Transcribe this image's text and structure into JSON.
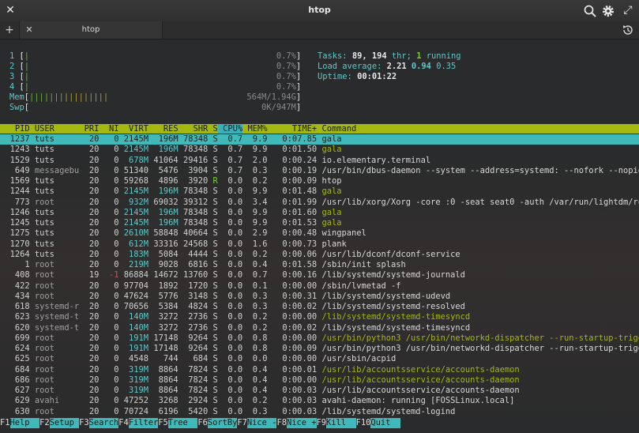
{
  "window": {
    "title": "htop"
  },
  "tabs": [
    {
      "label": "htop"
    }
  ],
  "meters": {
    "cpus": [
      {
        "num": "1",
        "pct": "0.7%"
      },
      {
        "num": "2",
        "pct": "0.7%"
      },
      {
        "num": "3",
        "pct": "0.7%"
      },
      {
        "num": "4",
        "pct": "0.7%"
      }
    ],
    "mem": {
      "label": "Mem",
      "value": "564M/1.94G",
      "fill": 0.29
    },
    "swp": {
      "label": "Swp",
      "value": "0K/947M",
      "fill": 0
    }
  },
  "stats": {
    "tasks_label": "Tasks:",
    "tasks": "89,",
    "threads": "194",
    "thr_label": "thr;",
    "running": "1",
    "running_label": "running",
    "load_label": "Load average:",
    "load1": "2.21",
    "load5": "0.94",
    "load15": "0.35",
    "uptime_label": "Uptime:",
    "uptime": "00:01:22"
  },
  "columns": [
    "PID",
    "USER",
    "PRI",
    "NI",
    "VIRT",
    "RES",
    "SHR",
    "S",
    "CPU%",
    "MEM%",
    "TIME+",
    "Command"
  ],
  "processes": [
    {
      "pid": "1237",
      "user": "tuts",
      "pri": "20",
      "ni": "0",
      "virt": "2145M",
      "res": "196M",
      "shr": "78348",
      "s": "S",
      "cpu": "0.7",
      "mem": "9.9",
      "time": "0:07.85",
      "cmd": "gala",
      "selected": true
    },
    {
      "pid": "1243",
      "user": "tuts",
      "pri": "20",
      "ni": "0",
      "virt": "2145M",
      "res": "196M",
      "shr": "78348",
      "s": "S",
      "cpu": "0.7",
      "mem": "9.9",
      "time": "0:01.50",
      "cmd": "gala",
      "thread": true
    },
    {
      "pid": "1529",
      "user": "tuts",
      "pri": "20",
      "ni": "0",
      "virt": "678M",
      "res": "41064",
      "shr": "29416",
      "s": "S",
      "cpu": "0.7",
      "mem": "2.0",
      "time": "0:00.24",
      "cmd": "io.elementary.terminal"
    },
    {
      "pid": "649",
      "user": "messagebu",
      "pri": "20",
      "ni": "0",
      "virt": "51340",
      "res": "5476",
      "shr": "3904",
      "s": "S",
      "cpu": "0.7",
      "mem": "0.3",
      "time": "0:00.19",
      "cmd": "/usr/bin/dbus-daemon --system --address=systemd: --nofork --nopid"
    },
    {
      "pid": "1569",
      "user": "tuts",
      "pri": "20",
      "ni": "0",
      "virt": "59268",
      "res": "4896",
      "shr": "3920",
      "s": "R",
      "cpu": "0.0",
      "mem": "0.2",
      "time": "0:00.09",
      "cmd": "htop"
    },
    {
      "pid": "1244",
      "user": "tuts",
      "pri": "20",
      "ni": "0",
      "virt": "2145M",
      "res": "196M",
      "shr": "78348",
      "s": "S",
      "cpu": "0.0",
      "mem": "9.9",
      "time": "0:01.48",
      "cmd": "gala",
      "thread": true
    },
    {
      "pid": "773",
      "user": "root",
      "pri": "20",
      "ni": "0",
      "virt": "932M",
      "res": "69032",
      "shr": "39312",
      "s": "S",
      "cpu": "0.0",
      "mem": "3.4",
      "time": "0:01.99",
      "cmd": "/usr/lib/xorg/Xorg -core :0 -seat seat0 -auth /var/run/lightdm/ro"
    },
    {
      "pid": "1246",
      "user": "tuts",
      "pri": "20",
      "ni": "0",
      "virt": "2145M",
      "res": "196M",
      "shr": "78348",
      "s": "S",
      "cpu": "0.0",
      "mem": "9.9",
      "time": "0:01.60",
      "cmd": "gala",
      "thread": true
    },
    {
      "pid": "1245",
      "user": "tuts",
      "pri": "20",
      "ni": "0",
      "virt": "2145M",
      "res": "196M",
      "shr": "78348",
      "s": "S",
      "cpu": "0.0",
      "mem": "9.9",
      "time": "0:01.53",
      "cmd": "gala",
      "thread": true
    },
    {
      "pid": "1275",
      "user": "tuts",
      "pri": "20",
      "ni": "0",
      "virt": "2610M",
      "res": "58848",
      "shr": "40664",
      "s": "S",
      "cpu": "0.0",
      "mem": "2.9",
      "time": "0:00.48",
      "cmd": "wingpanel"
    },
    {
      "pid": "1270",
      "user": "tuts",
      "pri": "20",
      "ni": "0",
      "virt": "612M",
      "res": "33316",
      "shr": "24568",
      "s": "S",
      "cpu": "0.0",
      "mem": "1.6",
      "time": "0:00.73",
      "cmd": "plank"
    },
    {
      "pid": "1264",
      "user": "tuts",
      "pri": "20",
      "ni": "0",
      "virt": "183M",
      "res": "5084",
      "shr": "4444",
      "s": "S",
      "cpu": "0.0",
      "mem": "0.2",
      "time": "0:00.06",
      "cmd": "/usr/lib/dconf/dconf-service"
    },
    {
      "pid": "1",
      "user": "root",
      "pri": "20",
      "ni": "0",
      "virt": "219M",
      "res": "9028",
      "shr": "6816",
      "s": "S",
      "cpu": "0.0",
      "mem": "0.4",
      "time": "0:01.58",
      "cmd": "/sbin/init splash"
    },
    {
      "pid": "408",
      "user": "root",
      "pri": "19",
      "ni": "-1",
      "virt": "86884",
      "res": "14672",
      "shr": "13760",
      "s": "S",
      "cpu": "0.0",
      "mem": "0.7",
      "time": "0:00.16",
      "cmd": "/lib/systemd/systemd-journald"
    },
    {
      "pid": "422",
      "user": "root",
      "pri": "20",
      "ni": "0",
      "virt": "97704",
      "res": "1892",
      "shr": "1720",
      "s": "S",
      "cpu": "0.0",
      "mem": "0.1",
      "time": "0:00.00",
      "cmd": "/sbin/lvmetad -f"
    },
    {
      "pid": "434",
      "user": "root",
      "pri": "20",
      "ni": "0",
      "virt": "47624",
      "res": "5776",
      "shr": "3148",
      "s": "S",
      "cpu": "0.0",
      "mem": "0.3",
      "time": "0:00.31",
      "cmd": "/lib/systemd/systemd-udevd"
    },
    {
      "pid": "618",
      "user": "systemd-r",
      "pri": "20",
      "ni": "0",
      "virt": "70656",
      "res": "5384",
      "shr": "4824",
      "s": "S",
      "cpu": "0.0",
      "mem": "0.3",
      "time": "0:00.02",
      "cmd": "/lib/systemd/systemd-resolved"
    },
    {
      "pid": "623",
      "user": "systemd-t",
      "pri": "20",
      "ni": "0",
      "virt": "140M",
      "res": "3272",
      "shr": "2736",
      "s": "S",
      "cpu": "0.0",
      "mem": "0.2",
      "time": "0:00.00",
      "cmd": "/lib/systemd/systemd-timesyncd",
      "thread": true
    },
    {
      "pid": "620",
      "user": "systemd-t",
      "pri": "20",
      "ni": "0",
      "virt": "140M",
      "res": "3272",
      "shr": "2736",
      "s": "S",
      "cpu": "0.0",
      "mem": "0.2",
      "time": "0:00.02",
      "cmd": "/lib/systemd/systemd-timesyncd"
    },
    {
      "pid": "699",
      "user": "root",
      "pri": "20",
      "ni": "0",
      "virt": "191M",
      "res": "17148",
      "shr": "9264",
      "s": "S",
      "cpu": "0.0",
      "mem": "0.8",
      "time": "0:00.00",
      "cmd": "/usr/bin/python3 /usr/bin/networkd-dispatcher --run-startup-trigg",
      "thread": true
    },
    {
      "pid": "624",
      "user": "root",
      "pri": "20",
      "ni": "0",
      "virt": "191M",
      "res": "17148",
      "shr": "9264",
      "s": "S",
      "cpu": "0.0",
      "mem": "0.8",
      "time": "0:00.09",
      "cmd": "/usr/bin/python3 /usr/bin/networkd-dispatcher --run-startup-trigg"
    },
    {
      "pid": "625",
      "user": "root",
      "pri": "20",
      "ni": "0",
      "virt": "4548",
      "res": "744",
      "shr": "684",
      "s": "S",
      "cpu": "0.0",
      "mem": "0.0",
      "time": "0:00.00",
      "cmd": "/usr/sbin/acpid"
    },
    {
      "pid": "684",
      "user": "root",
      "pri": "20",
      "ni": "0",
      "virt": "319M",
      "res": "8864",
      "shr": "7824",
      "s": "S",
      "cpu": "0.0",
      "mem": "0.4",
      "time": "0:00.01",
      "cmd": "/usr/lib/accountsservice/accounts-daemon",
      "thread": true
    },
    {
      "pid": "686",
      "user": "root",
      "pri": "20",
      "ni": "0",
      "virt": "319M",
      "res": "8864",
      "shr": "7824",
      "s": "S",
      "cpu": "0.0",
      "mem": "0.4",
      "time": "0:00.00",
      "cmd": "/usr/lib/accountsservice/accounts-daemon",
      "thread": true
    },
    {
      "pid": "627",
      "user": "root",
      "pri": "20",
      "ni": "0",
      "virt": "319M",
      "res": "8864",
      "shr": "7824",
      "s": "S",
      "cpu": "0.0",
      "mem": "0.4",
      "time": "0:00.03",
      "cmd": "/usr/lib/accountsservice/accounts-daemon"
    },
    {
      "pid": "629",
      "user": "avahi",
      "pri": "20",
      "ni": "0",
      "virt": "47252",
      "res": "3268",
      "shr": "2924",
      "s": "S",
      "cpu": "0.0",
      "mem": "0.2",
      "time": "0:00.03",
      "cmd": "avahi-daemon: running [FOSSLinux.local]"
    },
    {
      "pid": "630",
      "user": "root",
      "pri": "20",
      "ni": "0",
      "virt": "70724",
      "res": "6196",
      "shr": "5420",
      "s": "S",
      "cpu": "0.0",
      "mem": "0.3",
      "time": "0:00.03",
      "cmd": "/lib/systemd/systemd-logind"
    }
  ],
  "function_keys": [
    {
      "key": "F1",
      "label": "Help  "
    },
    {
      "key": "F2",
      "label": "Setup "
    },
    {
      "key": "F3",
      "label": "Search"
    },
    {
      "key": "F4",
      "label": "Filter"
    },
    {
      "key": "F5",
      "label": "Tree  "
    },
    {
      "key": "F6",
      "label": "SortBy"
    },
    {
      "key": "F7",
      "label": "Nice -"
    },
    {
      "key": "F8",
      "label": "Nice +"
    },
    {
      "key": "F9",
      "label": "Kill  "
    },
    {
      "key": "F10",
      "label": "Quit  "
    }
  ],
  "colors": {
    "header_bg": "#a5b80f",
    "selected_bg": "#3fb9b9",
    "titlebar": "#333333",
    "terminal_bg": "#2a2b2c"
  }
}
